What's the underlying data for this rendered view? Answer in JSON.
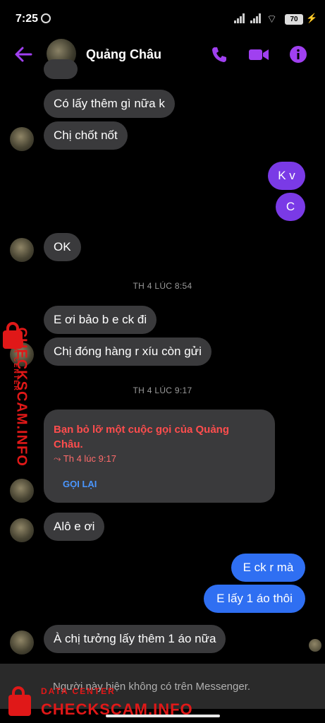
{
  "status_bar": {
    "time": "7:25",
    "battery": "70"
  },
  "header": {
    "contact_name": "Quảng Châu"
  },
  "messages": {
    "m1": "Có lấy thêm gì nữa k",
    "m2": "Chị chốt nốt",
    "m3": "K v",
    "m4": "C",
    "m5": "OK",
    "ts1": "TH 4 LÚC 8:54",
    "m6": "E ơi bảo b e ck đi",
    "m7": "Chị đóng hàng r xíu còn gửi",
    "ts2": "TH 4 LÚC 9:17",
    "m8": "Alô e ơi",
    "m9": "E ck r mà",
    "m10": "E lấy 1 áo thôi",
    "m11": "À chị tưởng lấy thêm 1 áo nữa"
  },
  "missed_call": {
    "title": "Bạn bỏ lỡ một cuộc gọi của Quảng Châu.",
    "time": "Th 4 lúc 9:17",
    "action": "GỌI LẠI"
  },
  "footer": {
    "note": "Người này hiện không có trên Messenger."
  },
  "watermark": {
    "sub": "DATA CENTER",
    "brand": "CHECKSCAM.INFO"
  },
  "colors": {
    "accent": "#a040f0",
    "outgoing": "#7a3ae6",
    "outgoing_blue": "#2f6ff2",
    "incoming": "#3a3a3c",
    "missed": "#ff4d4d"
  }
}
